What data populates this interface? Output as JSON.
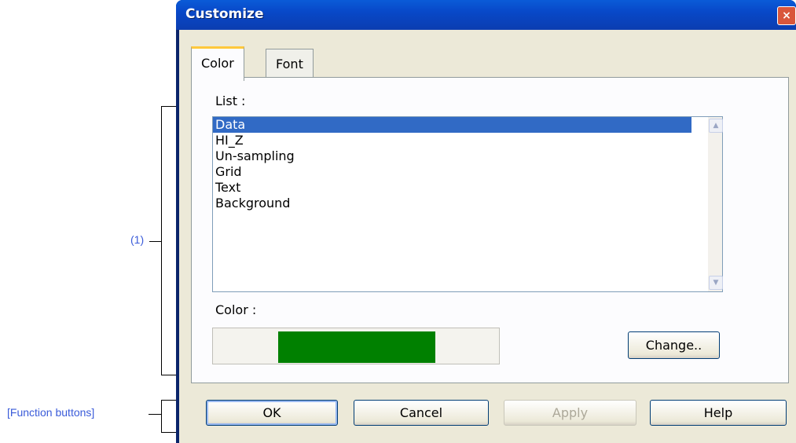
{
  "callouts": {
    "main_area": "(1)",
    "function_buttons": "[Function buttons]"
  },
  "dialog": {
    "title": "Customize",
    "close_glyph": "×",
    "tabs": [
      "Color",
      "Font"
    ],
    "list_label": "List :",
    "list_items": [
      "Data",
      "HI_Z",
      "Un-sampling",
      "Grid",
      "Text",
      "Background"
    ],
    "selected_item": "Data",
    "color_label": "Color :",
    "current_color": "#008000",
    "change_button": "Change..",
    "buttons": {
      "ok": "OK",
      "cancel": "Cancel",
      "apply": "Apply",
      "help": "Help"
    },
    "apply_enabled": false
  }
}
